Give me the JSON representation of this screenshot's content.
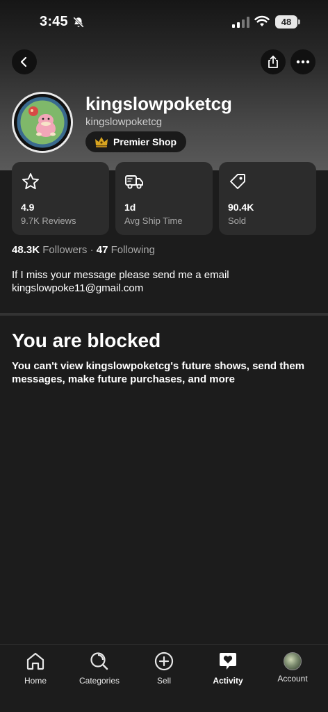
{
  "status_bar": {
    "time": "3:45",
    "battery": "48"
  },
  "profile": {
    "username": "kingslowpoketcg",
    "handle": "kingslowpoketcg",
    "badge": "Premier Shop"
  },
  "stats": [
    {
      "icon": "star-icon",
      "value": "4.9",
      "label": "9.7K Reviews"
    },
    {
      "icon": "truck-icon",
      "value": "1d",
      "label": "Avg Ship Time"
    },
    {
      "icon": "tag-icon",
      "value": "90.4K",
      "label": "Sold"
    }
  ],
  "follow": {
    "followers_count": "48.3K",
    "followers_label": "Followers",
    "separator": "·",
    "following_count": "47",
    "following_label": "Following"
  },
  "bio": {
    "line1": "If I miss your message please send me a email",
    "line2": "kingslowpoke11@gmail.com"
  },
  "blocked": {
    "title": "You are blocked",
    "message": "You can't view kingslowpoketcg's future shows, send them messages, make future purchases, and more"
  },
  "tabbar": {
    "home": "Home",
    "categories": "Categories",
    "sell": "Sell",
    "activity": "Activity",
    "account": "Account",
    "active": "activity"
  },
  "colors": {
    "background": "#1c1c1c",
    "card": "#2c2c2c",
    "muted_text": "#a9a9a9",
    "badge_gold": "#d9a520"
  }
}
